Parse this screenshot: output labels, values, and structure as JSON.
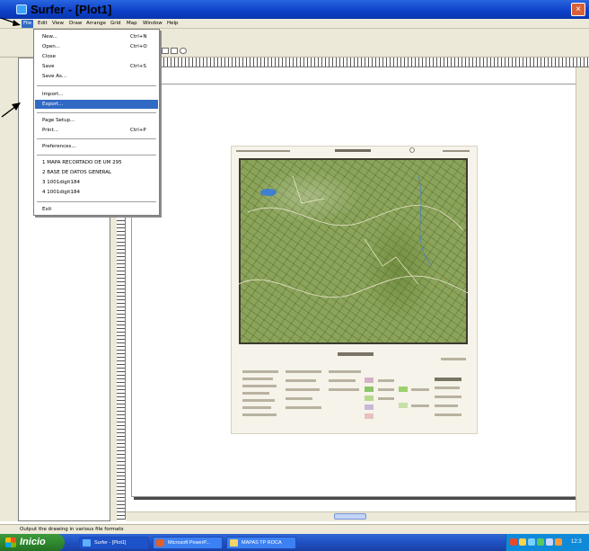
{
  "window": {
    "title": "Surfer - [Plot1]",
    "close_glyph": "×"
  },
  "menubar": {
    "items": [
      "File",
      "Edit",
      "View",
      "Draw",
      "Arrange",
      "Grid",
      "Map",
      "Window",
      "Help"
    ]
  },
  "file_menu": {
    "new": {
      "label": "New...",
      "shortcut": "Ctrl+N"
    },
    "open": {
      "label": "Open...",
      "shortcut": "Ctrl+O"
    },
    "close": {
      "label": "Close"
    },
    "save": {
      "label": "Save",
      "shortcut": "Ctrl+S"
    },
    "save_as": {
      "label": "Save As..."
    },
    "import": {
      "label": "Import..."
    },
    "export": {
      "label": "Export..."
    },
    "page_setup": {
      "label": "Page Setup..."
    },
    "print": {
      "label": "Print...",
      "shortcut": "Ctrl+P"
    },
    "preferences": {
      "label": "Preferences..."
    },
    "recent": [
      "1 MAPA RECORTADO DE UM 295",
      "2 BASE DE DATOS GENERAL",
      "3 1001digit184",
      "4 1001digit184"
    ],
    "exit": {
      "label": "Exit"
    }
  },
  "statusbar": {
    "text": "Output the drawing in various file formats"
  },
  "taskbar": {
    "start_label": "Inicio",
    "buttons": [
      "Surfer - [Plot1]",
      "Microsoft PowerP...",
      "MAPAS TP ROCA"
    ],
    "clock": "12:3"
  },
  "colors": {
    "titlebar": "#0b3fc7",
    "menu_highlight": "#316ac5",
    "taskbar": "#1f50c2",
    "start_button": "#2f8a2f",
    "map_green": "#8aa55a"
  }
}
